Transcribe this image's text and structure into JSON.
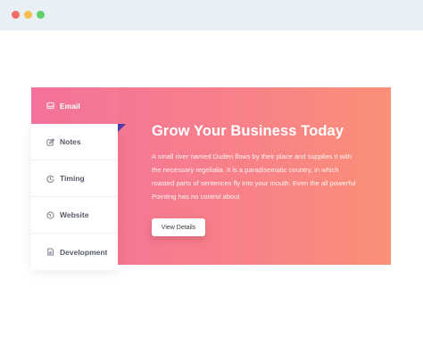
{
  "window": {
    "controls": [
      "close",
      "minimize",
      "maximize"
    ],
    "colors": {
      "close": "#f26c6c",
      "minimize": "#f4bf4f",
      "maximize": "#5fcf6b"
    }
  },
  "tabs": [
    {
      "label": "Email",
      "icon": "inbox-icon",
      "active": true
    },
    {
      "label": "Notes",
      "icon": "edit-icon",
      "active": false
    },
    {
      "label": "Timing",
      "icon": "clock-icon",
      "active": false
    },
    {
      "label": "Website",
      "icon": "globe-icon",
      "active": false
    },
    {
      "label": "Development",
      "icon": "document-icon",
      "active": false
    }
  ],
  "content": {
    "heading": "Grow Your Business Today",
    "body": "A small river named Duden flows by their place and supplies it with the necessary regelialia. It is a paradisematic country, in which roasted parts of sentences fly into your mouth. Even the all powerful Pointing has no control about",
    "button_label": "View Details"
  },
  "colors": {
    "gradient_start": "#f3719a",
    "gradient_end": "#fb8f77",
    "titlebar": "#e8eff5"
  }
}
